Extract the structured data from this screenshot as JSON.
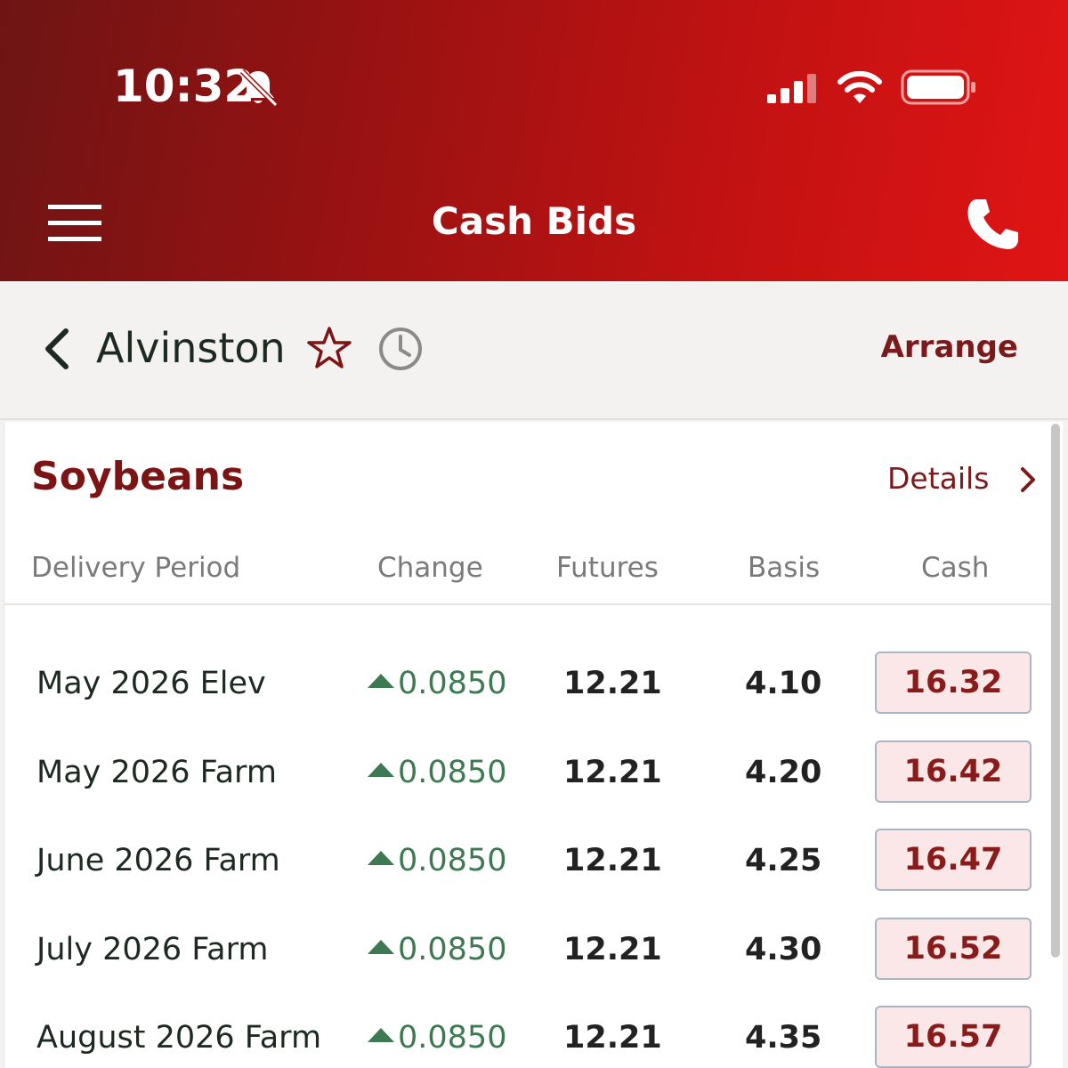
{
  "status_bar": {
    "time": "10:32",
    "icons": [
      "bell-slash-icon",
      "cellular-signal-icon",
      "wifi-icon",
      "battery-icon"
    ]
  },
  "nav": {
    "title": "Cash Bids",
    "left_icon": "menu-icon",
    "right_icon": "phone-icon"
  },
  "location_bar": {
    "location": "Alvinston",
    "arrange_label": "Arrange",
    "icons": [
      "back-chevron-icon",
      "star-icon",
      "clock-icon"
    ]
  },
  "card": {
    "commodity": "Soybeans",
    "details_label": "Details",
    "columns": [
      "Delivery Period",
      "Change",
      "Futures",
      "Basis",
      "Cash"
    ],
    "rows": [
      {
        "period": "May 2026 Elev",
        "change": "0.0850",
        "futures": "12.21",
        "basis": "4.10",
        "cash": "16.32"
      },
      {
        "period": "May 2026 Farm",
        "change": "0.0850",
        "futures": "12.21",
        "basis": "4.20",
        "cash": "16.42"
      },
      {
        "period": "June 2026 Farm",
        "change": "0.0850",
        "futures": "12.21",
        "basis": "4.25",
        "cash": "16.47"
      },
      {
        "period": "July 2026 Farm",
        "change": "0.0850",
        "futures": "12.21",
        "basis": "4.30",
        "cash": "16.52"
      },
      {
        "period": "August 2026 Farm",
        "change": "0.0850",
        "futures": "12.21",
        "basis": "4.35",
        "cash": "16.57"
      }
    ]
  },
  "colors": {
    "header_dark": "#6e1414",
    "header_light": "#e01414",
    "brand_text": "#7d1414",
    "change_up": "#3d7a52",
    "cash_bg": "#fbe7e7"
  }
}
